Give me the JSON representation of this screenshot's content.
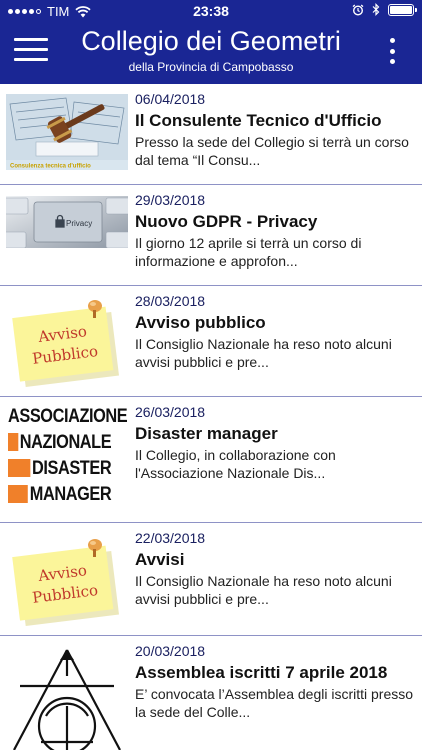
{
  "status_bar": {
    "carrier": "TIM",
    "time": "23:38"
  },
  "header": {
    "title": "Collegio dei Geometri",
    "subtitle": "della Provincia di Campobasso"
  },
  "thumbs": {
    "privacy_key_text": "Privacy",
    "avviso_line1": "Avviso",
    "avviso_line2": "Pubblico",
    "logo_lines": [
      "ASSOCIAZIONE",
      "NAZIONALE",
      "DISASTER",
      "MANAGER"
    ],
    "office_caption": "Consulenza tecnica d'ufficio"
  },
  "news": [
    {
      "date": "06/04/2018",
      "title": "Il Consulente Tecnico d'Ufficio",
      "excerpt": "Presso la sede del Collegio si terrà un corso dal tema “Il Consu..."
    },
    {
      "date": "29/03/2018",
      "title": "Nuovo GDPR - Privacy",
      "excerpt": "Il giorno 12 aprile si terrà un corso di informazione e approfon..."
    },
    {
      "date": "28/03/2018",
      "title": "Avviso pubblico",
      "excerpt": "Il Consiglio Nazionale ha reso noto alcuni avvisi pubblici e pre..."
    },
    {
      "date": "26/03/2018",
      "title": "Disaster manager",
      "excerpt": " Il Collegio, in collaborazione con l'Associazione Nazionale Dis..."
    },
    {
      "date": "22/03/2018",
      "title": "Avvisi",
      "excerpt": "Il Consiglio Nazionale ha reso noto alcuni avvisi pubblici e pre..."
    },
    {
      "date": "20/03/2018",
      "title": "Assemblea iscritti 7 aprile 2018",
      "excerpt": "E’ convocata l’Assemblea degli iscritti presso la sede del Colle..."
    }
  ],
  "colors": {
    "header_bg": "#1a2694",
    "date_text": "#1a2060",
    "divider": "#8e92c6",
    "sticky_note": "#fbf59a",
    "logo_accent": "#f0802a"
  },
  "icons": {
    "menu": "hamburger-menu-icon",
    "more": "vertical-dots-icon",
    "wifi": "wifi-icon",
    "alarm": "alarm-icon",
    "bluetooth": "bluetooth-icon",
    "battery": "battery-icon"
  }
}
